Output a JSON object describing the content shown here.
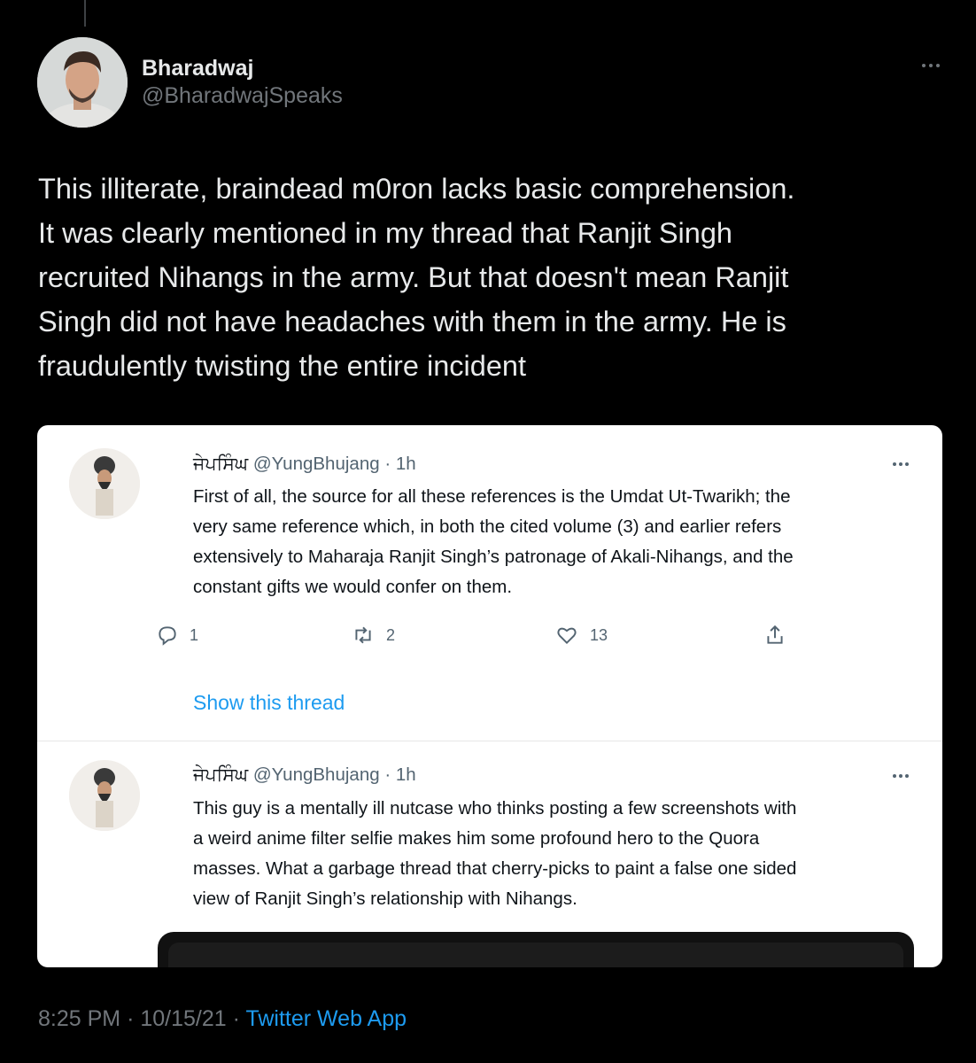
{
  "tweet": {
    "author_name": "Bharadwaj",
    "author_handle": "@BharadwajSpeaks",
    "text_lines": [
      "This illiterate, braindead m0ron lacks basic comprehension.",
      "It was clearly mentioned in my thread that Ranjit Singh",
      "recruited Nihangs in the army. But that doesn't mean Ranjit",
      "Singh did not have headaches with them in the army. He is",
      "fraudulently twisting the entire incident"
    ],
    "time": "8:25 PM",
    "date": "10/15/21",
    "source": "Twitter Web App",
    "separator": "·"
  },
  "quoted": {
    "first": {
      "name": "ਜੇਪਸਿੰਘ",
      "handle": "@YungBhujang",
      "time": "1h",
      "separator": "·",
      "text_lines": [
        "First of all, the source for all these references is the Umdat Ut-Twarikh; the",
        "very same reference which, in both the cited volume (3) and earlier refers",
        "extensively to Maharaja Ranjit Singh’s patronage of Akali-Nihangs, and the",
        "constant gifts we would confer on them."
      ],
      "replies": "1",
      "retweets": "2",
      "likes": "13",
      "show_thread": "Show this thread"
    },
    "second": {
      "name": "ਜੇਪਸਿੰਘ",
      "handle": "@YungBhujang",
      "time": "1h",
      "separator": "·",
      "text_lines": [
        "This guy is a mentally ill nutcase who thinks posting a few screenshots with",
        "a weird anime filter selfie makes him some profound hero to the Quora",
        "masses. What a garbage thread that cherry-picks to paint a false one sided",
        "view of Ranjit Singh’s relationship with Nihangs."
      ]
    }
  },
  "colors": {
    "background": "#000000",
    "primary_text": "#e7e9ea",
    "secondary_text": "#71767b",
    "link": "#1d9bf0",
    "card_background": "#ffffff"
  }
}
